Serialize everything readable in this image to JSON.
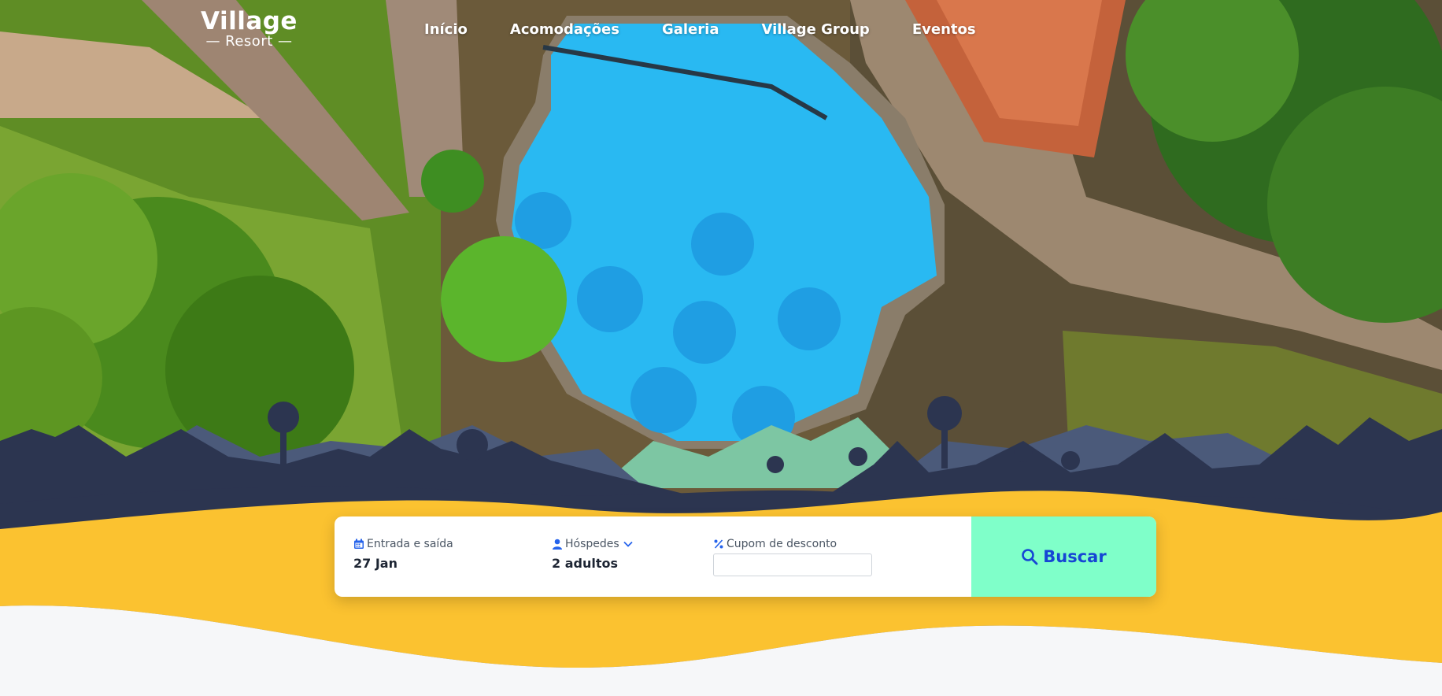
{
  "brand": {
    "name": "Village",
    "tagline": "— Resort —"
  },
  "nav": {
    "items": [
      {
        "label": "Início"
      },
      {
        "label": "Acomodações"
      },
      {
        "label": "Galeria"
      },
      {
        "label": "Village Group"
      },
      {
        "label": "Eventos"
      }
    ]
  },
  "booking": {
    "dates_label": "Entrada e saída",
    "dates_value": "27 Jan",
    "guests_label": "Hóspedes",
    "guests_value": "2 adultos",
    "coupon_label": "Cupom de desconto",
    "coupon_value": "",
    "search_label": "Buscar"
  },
  "icons": {
    "calendar": "calendar-icon",
    "user": "user-icon",
    "chevron": "chevron-down-icon",
    "percent": "percent-icon",
    "search": "search-icon"
  },
  "colors": {
    "accent": "#7fffc9",
    "accent_text": "#1646d4",
    "icon_blue": "#2563eb",
    "wave_yellow": "#fbc230",
    "wave_navy": "#2c3550",
    "pool_blue": "#29b9f2",
    "background": "#f6f7f9"
  }
}
